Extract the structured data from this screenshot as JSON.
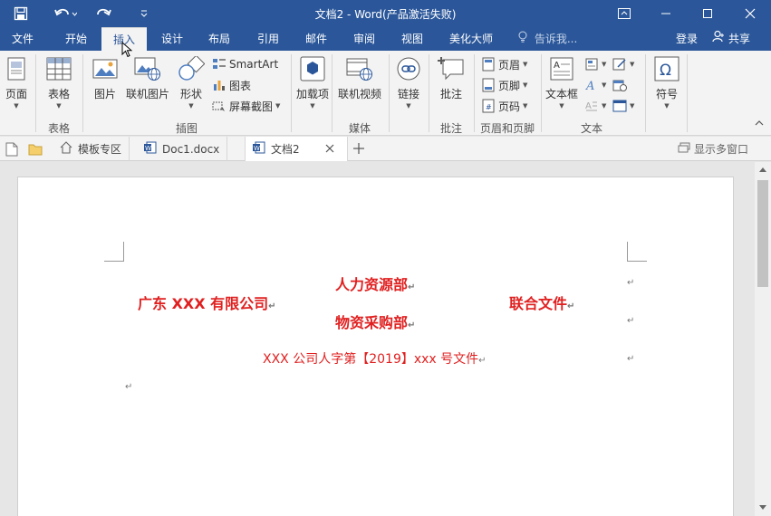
{
  "window": {
    "title": "文档2 - Word(产品激活失败)"
  },
  "tabs": [
    {
      "label": "文件"
    },
    {
      "label": "开始"
    },
    {
      "label": "插入"
    },
    {
      "label": "设计"
    },
    {
      "label": "布局"
    },
    {
      "label": "引用"
    },
    {
      "label": "邮件"
    },
    {
      "label": "审阅"
    },
    {
      "label": "视图"
    },
    {
      "label": "美化大师"
    }
  ],
  "tell_me": "告诉我...",
  "login": "登录",
  "share": "共享",
  "ribbon": {
    "page": "页面",
    "table": "表格",
    "picture": "图片",
    "online_picture": "联机图片",
    "shapes": "形状",
    "smartart": "SmartArt",
    "chart": "图表",
    "screenshot": "屏幕截图",
    "addins": "加载项",
    "online_video": "联机视频",
    "link": "链接",
    "comment": "批注",
    "header": "页眉",
    "footer": "页脚",
    "page_number": "页码",
    "textbox": "文本框",
    "symbol": "符号",
    "groups": {
      "table": "表格",
      "illustrations": "插图",
      "media": "媒体",
      "comments": "批注",
      "header_footer": "页眉和页脚",
      "text": "文本"
    }
  },
  "doc_tabs": [
    {
      "label": "模板专区"
    },
    {
      "label": "Doc1.docx"
    },
    {
      "label": "文档2"
    }
  ],
  "show_multi_window": "显示多窗口",
  "document": {
    "company": "广东 XXX 有限公司",
    "dept1": "人力资源部",
    "dept2": "物资采购部",
    "joint": "联合文件",
    "doc_number": "XXX 公司人字第【2019】xxx 号文件",
    "para_mark": "↵"
  },
  "colors": {
    "accent": "#2b579a",
    "doc_red": "#e02020"
  }
}
